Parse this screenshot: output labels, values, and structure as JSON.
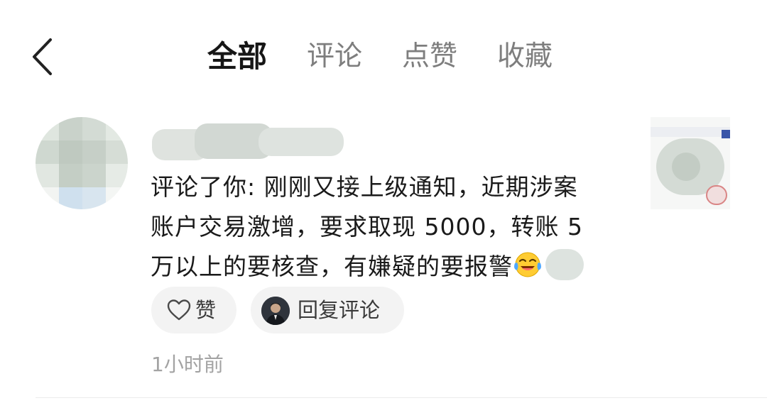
{
  "header": {
    "back_icon": "chevron-left-icon",
    "tabs": [
      {
        "label": "全部",
        "active": true
      },
      {
        "label": "评论",
        "active": false
      },
      {
        "label": "点赞",
        "active": false
      },
      {
        "label": "收藏",
        "active": false
      }
    ]
  },
  "notification": {
    "comment_lines": [
      "评论了你: 刚刚又接上级通知，近期涉案",
      "账户交易激增，要求取现 5000，转账 5",
      "万以上的要核查，有嫌疑的要报警"
    ],
    "emoji_icon": "face-with-tears-of-joy-icon",
    "like_label": "赞",
    "reply_label": "回复评论",
    "time": "1小时前"
  },
  "colors": {
    "active_tab": "#161616",
    "inactive_tab": "#7e7e7e",
    "pill_bg": "#f3f3f3",
    "time_text": "#a3a3a3"
  }
}
